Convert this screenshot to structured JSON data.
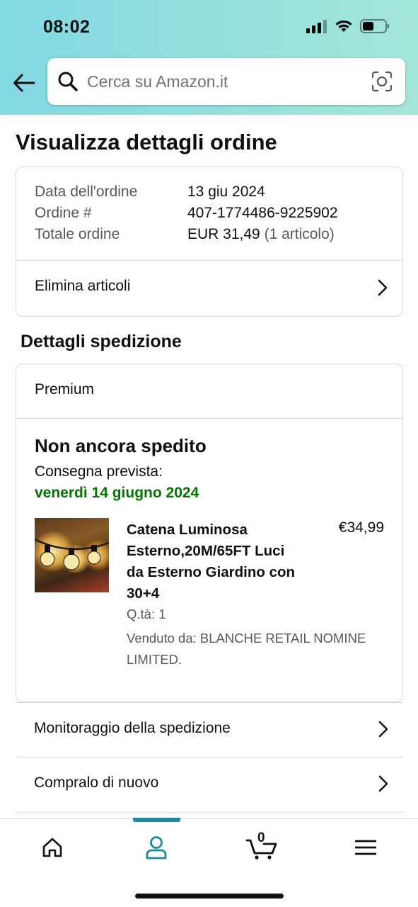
{
  "status_bar": {
    "time": "08:02"
  },
  "search": {
    "placeholder": "Cerca su Amazon.it"
  },
  "page_title": "Visualizza dettagli ordine",
  "order_summary": {
    "rows": [
      {
        "label": "Data dell'ordine",
        "value": "13 giu 2024"
      },
      {
        "label": "Ordine #",
        "value": "407-1774486-9225902"
      },
      {
        "label": "Totale ordine",
        "value": "EUR 31,49",
        "note": "(1 articolo)"
      }
    ],
    "delete_items_label": "Elimina articoli"
  },
  "shipping": {
    "section_title": "Dettagli spedizione",
    "type": "Premium",
    "status": "Non ancora spedito",
    "delivery_label": "Consegna prevista:",
    "delivery_date": "venerdì 14 giugno 2024",
    "delivery_date_color": "#007600",
    "product": {
      "title": "Catena Luminosa Esterno,20M/65FT Luci da Esterno Giardino con 30+4",
      "price": "€34,99",
      "quantity": "Q.tà: 1",
      "seller": "Venduto da: BLANCHE RETAIL NOMINE LIMITED."
    }
  },
  "actions": [
    {
      "label": "Monitoraggio della spedizione"
    },
    {
      "label": "Compralo di nuovo"
    }
  ],
  "tabbar": {
    "active_tab": "account",
    "accent_color": "#1a8a9c",
    "tabs": [
      {
        "id": "home",
        "icon": "home-icon"
      },
      {
        "id": "account",
        "icon": "user-icon"
      },
      {
        "id": "cart",
        "icon": "cart-icon",
        "count": "0"
      },
      {
        "id": "menu",
        "icon": "menu-icon"
      }
    ]
  }
}
